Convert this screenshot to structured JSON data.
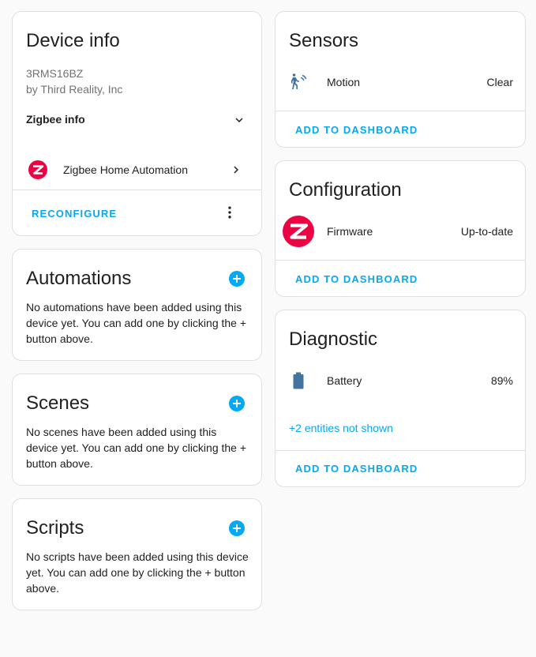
{
  "device_info": {
    "title": "Device info",
    "model": "3RMS16BZ",
    "manufacturer": "by Third Reality, Inc",
    "zigbee_info_label": "Zigbee info",
    "integration_label": "Zigbee Home Automation",
    "reconfigure_label": "RECONFIGURE"
  },
  "automations": {
    "title": "Automations",
    "text": "No automations have been added using this device yet. You can add one by clicking the + button above."
  },
  "scenes": {
    "title": "Scenes",
    "text": "No scenes have been added using this device yet. You can add one by clicking the + button above."
  },
  "scripts": {
    "title": "Scripts",
    "text": "No scripts have been added using this device yet. You can add one by clicking the + button above."
  },
  "sensors": {
    "title": "Sensors",
    "rows": [
      {
        "icon": "motion-sensor-icon",
        "label": "Motion",
        "value": "Clear"
      }
    ],
    "action_label": "ADD TO DASHBOARD"
  },
  "configuration": {
    "title": "Configuration",
    "rows": [
      {
        "icon": "zigbee-logo",
        "label": "Firmware",
        "value": "Up-to-date"
      }
    ],
    "action_label": "ADD TO DASHBOARD"
  },
  "diagnostic": {
    "title": "Diagnostic",
    "rows": [
      {
        "icon": "battery-icon",
        "label": "Battery",
        "value": "89%"
      }
    ],
    "hidden_link": "+2 entities not shown",
    "action_label": "ADD TO DASHBOARD"
  },
  "colors": {
    "accent": "#03a9f4",
    "zigbee_brand": "#eb0443",
    "icon": "#44739e"
  }
}
